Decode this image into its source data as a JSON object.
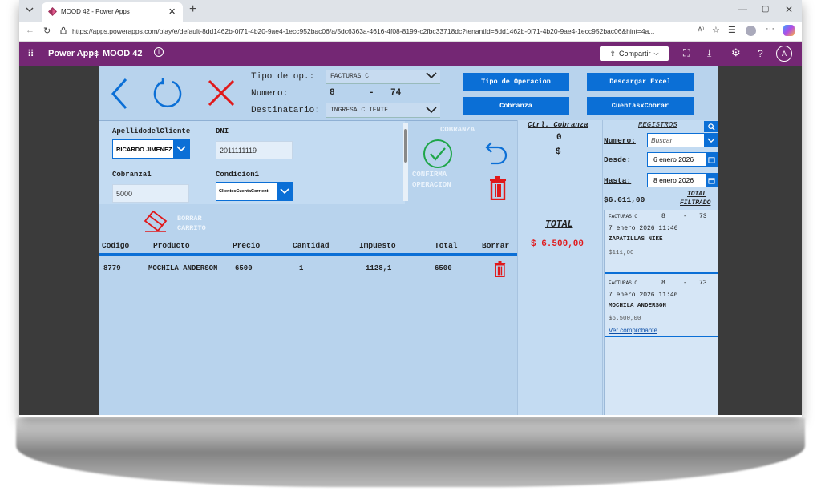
{
  "browser": {
    "tab_title": "MOOD 42 - Power Apps",
    "url": "https://apps.powerapps.com/play/e/default-8dd1462b-0f71-4b20-9ae4-1ecc952bac06/a/5dc6363a-4616-4f08-8199-c2fbc33718dc?tenantId=8dd1462b-0f71-4b20-9ae4-1ecc952bac06&hint=4a...",
    "profile_initial": "A"
  },
  "header": {
    "brand": "Power Apps",
    "separator": "|",
    "app_name": "MOOD 42",
    "share_label": "Compartir",
    "help": "?",
    "user_initial": "A"
  },
  "form": {
    "tipo_label": "Tipo de op.:",
    "tipo_value": "FACTURAS C",
    "numero_label": "Numero:",
    "numero_a": "8",
    "numero_sep": "-",
    "numero_b": "74",
    "dest_label": "Destinatario:",
    "dest_value": "INGRESA CLIENTE",
    "btn_tipo": "Tipo de Operacion",
    "btn_excel": "Descargar Excel",
    "btn_cobranza": "Cobranza",
    "btn_cuentas": "CuentasxCobrar"
  },
  "client": {
    "apellido_label": "ApellidodelCliente",
    "apellido_value": "RICARDO JIMENEZ",
    "dni_label": "DNI",
    "dni_value": "2011111119",
    "cobranza_label": "Cobranza1",
    "cobranza_value": "5000",
    "condicion_label": "Condicion1",
    "condicion_value": "ClientesCuentaCorrient"
  },
  "actions": {
    "cobranza_title": "COBRANZA",
    "confirma": "CONFIRMA",
    "operacion": "OPERACION",
    "borrar": "BORRAR",
    "carrito": "CARRITO"
  },
  "ctrl": {
    "title": "Ctrl. Cobranza",
    "count": "0",
    "currency": "$",
    "total_label": "TOTAL",
    "total_value": "$ 6.500,00"
  },
  "table": {
    "headers": [
      "Codigo",
      "Producto",
      "Precio",
      "Cantidad",
      "Impuesto",
      "Total",
      "Borrar"
    ],
    "rows": [
      {
        "codigo": "8779",
        "producto": "MOCHILA ANDERSON",
        "precio": "6500",
        "cantidad": "1",
        "impuesto": "1128,1",
        "total": "6500"
      }
    ]
  },
  "registros": {
    "title": "REGISTROS",
    "numero_label": "Numero:",
    "numero_placeholder": "Buscar",
    "desde_label": "Desde:",
    "desde_value": "6 enero 2026",
    "hasta_label": "Hasta:",
    "hasta_value": "8 enero 2026",
    "total_amount": "$6.611,00",
    "total_label_1": "TOTAL",
    "total_label_2": "FILTRADO",
    "cards": [
      {
        "tipo": "FACTURAS C",
        "n1": "8",
        "sep": "-",
        "n2": "73",
        "fecha": "7 enero 2026 11:46",
        "producto": "ZAPATILLAS NIKE",
        "monto": "$111,00",
        "link": ""
      },
      {
        "tipo": "FACTURAS C",
        "n1": "8",
        "sep": "-",
        "n2": "73",
        "fecha": "7 enero 2026 11:46",
        "producto": "MOCHILA ANDERSON",
        "monto": "$6.500,00",
        "link": "Ver comprobante"
      }
    ]
  },
  "colors": {
    "header_purple": "#742774",
    "app_bg": "#b8d3ed",
    "button_blue": "#0b6fd6",
    "danger_red": "#e0191b",
    "confirm_green": "#1fa64a"
  }
}
